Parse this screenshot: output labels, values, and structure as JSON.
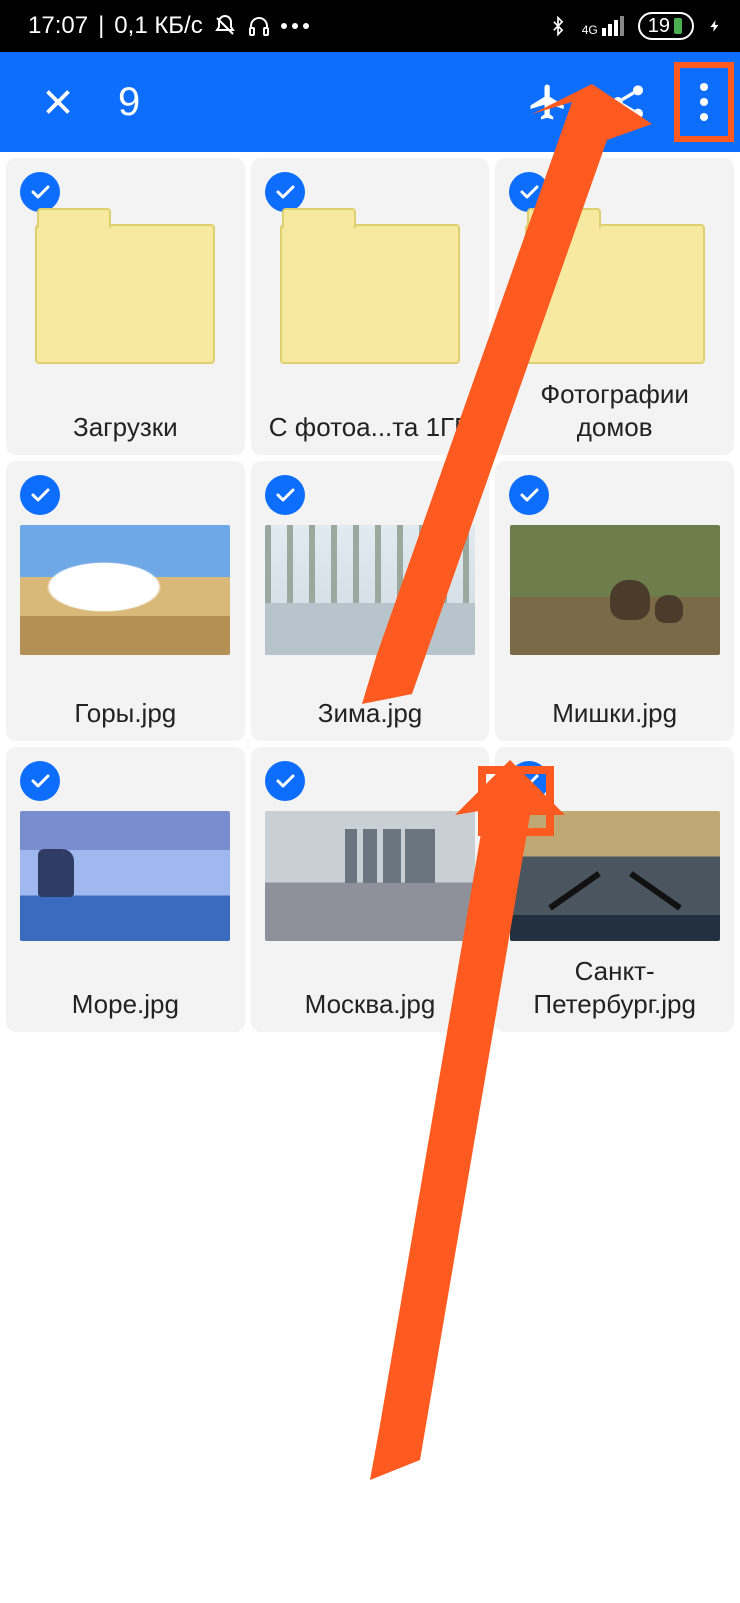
{
  "status": {
    "time": "17:07",
    "net_speed": "0,1 КБ/с",
    "net_label": "4G",
    "battery": "19"
  },
  "appbar": {
    "selected_count": "9"
  },
  "items": [
    {
      "label": "Загрузки",
      "type": "folder"
    },
    {
      "label": "С фотоа...та 1ГБ",
      "type": "folder"
    },
    {
      "label": "Фотографии домов",
      "type": "folder"
    },
    {
      "label": "Горы.jpg",
      "type": "image",
      "thumb": "th-mountain"
    },
    {
      "label": "Зима.jpg",
      "type": "image",
      "thumb": "th-winter"
    },
    {
      "label": "Мишки.jpg",
      "type": "image",
      "thumb": "th-bears"
    },
    {
      "label": "Море.jpg",
      "type": "image",
      "thumb": "th-sea"
    },
    {
      "label": "Москва.jpg",
      "type": "image",
      "thumb": "th-moscow"
    },
    {
      "label": "Санкт-Петербург.jpg",
      "type": "image",
      "thumb": "th-spb"
    }
  ],
  "annotations": {
    "highlight_more_menu": true,
    "highlight_item_checkbox_index": 8
  }
}
